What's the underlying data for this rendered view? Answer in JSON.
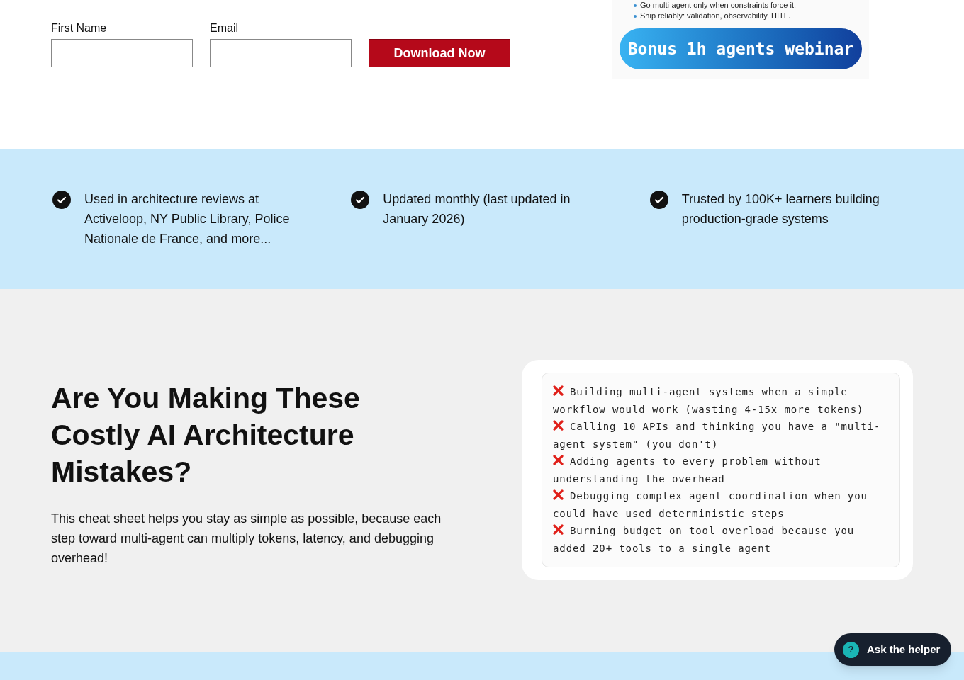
{
  "form": {
    "fields": [
      {
        "label": "First Name"
      },
      {
        "label": "Email"
      }
    ],
    "submit": "Download Now"
  },
  "promo_image": {
    "bullets": [
      "Go multi-agent only when constraints force it.",
      "Ship reliably: validation, observability, HITL."
    ],
    "badge": "Bonus 1h agents webinar"
  },
  "features": [
    {
      "text": "Used in architecture reviews at Activeloop, NY Public Library, Police Nationale de France, and more..."
    },
    {
      "text": "Updated monthly (last updated in January 2026)"
    },
    {
      "text": "Trusted by 100K+ learners building production-grade systems"
    }
  ],
  "mistakes_section": {
    "heading": "Are You Making These Costly AI Architecture Mistakes?",
    "body": "This cheat sheet helps you stay as simple as possible, because each step toward multi-agent can multiply tokens, latency, and debugging overhead!",
    "mistakes": [
      "Building multi-agent systems when a simple workflow would work (wasting 4-15x more tokens)",
      "Calling 10 APIs and thinking you have a \"multi-agent system\" (you don't)",
      "Adding agents to every problem without understanding the overhead",
      "Debugging complex agent coordination when you could have used deterministic steps",
      "Burning budget on tool overload because you added 20+ tools to a single agent"
    ]
  },
  "helper": {
    "icon": "?",
    "label": "Ask the helper"
  }
}
